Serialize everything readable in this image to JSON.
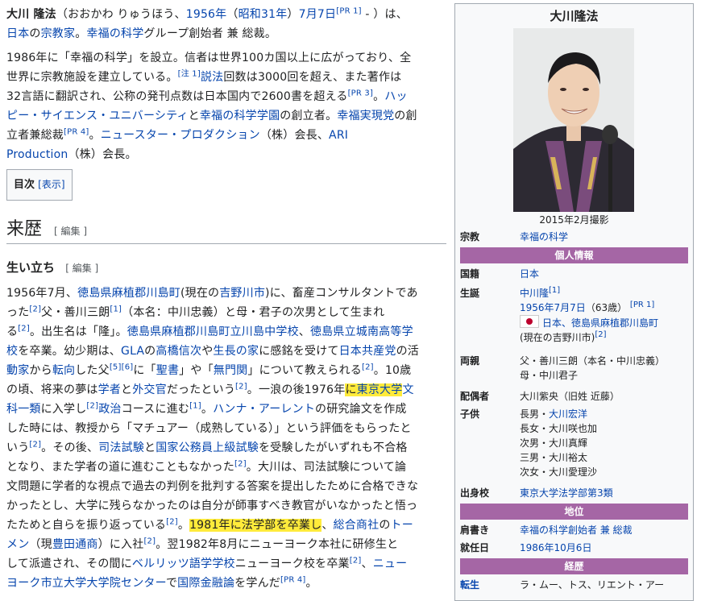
{
  "intro": {
    "p1": [
      {
        "t": "大川 隆法",
        "b": true
      },
      {
        "t": "（おおかわ りゅうほう、"
      },
      {
        "t": "1956年",
        "a": true
      },
      {
        "t": "（"
      },
      {
        "t": "昭和31年",
        "a": true
      },
      {
        "t": "）"
      },
      {
        "t": "7月7日",
        "a": true
      },
      {
        "t": "[PR 1]",
        "sup": true
      },
      {
        "t": " - ）は、"
      },
      {
        "br": true
      },
      {
        "t": "日本",
        "a": true
      },
      {
        "t": "の"
      },
      {
        "t": "宗教家",
        "a": true
      },
      {
        "t": "。"
      },
      {
        "t": "幸福の科学",
        "a": true
      },
      {
        "t": "グループ創始者 兼 総裁。"
      }
    ],
    "p2": [
      {
        "t": "1986年に「幸福の科学」を設立。信者は世界100カ国以上に広がっており、全"
      },
      {
        "br": true
      },
      {
        "t": "世界に宗教施設を建立している。"
      },
      {
        "t": "[注 1]",
        "sup": true
      },
      {
        "t": "説法",
        "a": true
      },
      {
        "t": "回数は3000回を超え、また著作は"
      },
      {
        "br": true
      },
      {
        "t": "32言語に翻訳され、公称の発刊点数は日本国内で2600書を超える"
      },
      {
        "t": "[PR 3]",
        "sup": true
      },
      {
        "t": "。"
      },
      {
        "t": "ハッ",
        "a": true
      },
      {
        "br": true
      },
      {
        "t": "ピー・サイエンス・ユニバーシティ",
        "a": true
      },
      {
        "t": "と"
      },
      {
        "t": "幸福の科学学園",
        "a": true
      },
      {
        "t": "の創立者。"
      },
      {
        "t": "幸福実現党",
        "a": true
      },
      {
        "t": "の創"
      },
      {
        "br": true
      },
      {
        "t": "立者兼総裁"
      },
      {
        "t": "[PR 4]",
        "sup": true
      },
      {
        "t": "。"
      },
      {
        "t": "ニュースター・プロダクション",
        "a": true
      },
      {
        "t": "（株）会長、"
      },
      {
        "t": "ARI",
        "a": true
      },
      {
        "br": true
      },
      {
        "t": "Production",
        "a": true
      },
      {
        "t": "（株）会長。"
      }
    ]
  },
  "toc": {
    "title": "目次",
    "toggle": "[表示]"
  },
  "section": {
    "title": "来歴",
    "edit": "[ 編集 ]"
  },
  "subsection": {
    "title": "生い立ち",
    "edit": "[ 編集 ]"
  },
  "body": [
    {
      "t": "1956年7月、"
    },
    {
      "t": "徳島県麻植郡川島町",
      "a": true
    },
    {
      "t": "(現在の"
    },
    {
      "t": "吉野川市",
      "a": true
    },
    {
      "t": ")に、畜産コンサルタントであ"
    },
    {
      "br": true
    },
    {
      "t": "った"
    },
    {
      "t": "[2]",
      "sup": true
    },
    {
      "t": "父・善川三朗"
    },
    {
      "t": "[1]",
      "sup": true
    },
    {
      "t": "（本名：中川忠義）と母・君子の次男として生まれ"
    },
    {
      "br": true
    },
    {
      "t": "る"
    },
    {
      "t": "[2]",
      "sup": true
    },
    {
      "t": "。出生名は「隆」。"
    },
    {
      "t": "徳島県麻植郡川島町立川島中学校",
      "a": true
    },
    {
      "t": "、"
    },
    {
      "t": "徳島県立城南高等学",
      "a": true
    },
    {
      "br": true
    },
    {
      "t": "校",
      "a": true
    },
    {
      "t": "を卒業。幼少期は、"
    },
    {
      "t": "GLA",
      "a": true
    },
    {
      "t": "の"
    },
    {
      "t": "高橋信次",
      "a": true
    },
    {
      "t": "や"
    },
    {
      "t": "生長の家",
      "a": true
    },
    {
      "t": "に感銘を受けて"
    },
    {
      "t": "日本共産党",
      "a": true
    },
    {
      "t": "の活"
    },
    {
      "br": true
    },
    {
      "t": "動家",
      "a": true
    },
    {
      "t": "から"
    },
    {
      "t": "転向",
      "a": true
    },
    {
      "t": "した父"
    },
    {
      "t": "[5][6]",
      "sup": true
    },
    {
      "t": "に「"
    },
    {
      "t": "聖書",
      "a": true
    },
    {
      "t": "」や「"
    },
    {
      "t": "無門関",
      "a": true
    },
    {
      "t": "」について教えられる"
    },
    {
      "t": "[2]",
      "sup": true
    },
    {
      "t": "。10歳"
    },
    {
      "br": true
    },
    {
      "t": "の頃、将来の夢は"
    },
    {
      "t": "学者",
      "a": true
    },
    {
      "t": "と"
    },
    {
      "t": "外交官",
      "a": true
    },
    {
      "t": "だったという"
    },
    {
      "t": "[2]",
      "sup": true
    },
    {
      "t": "。一浪の後1976年"
    },
    {
      "t": "に",
      "hl": true
    },
    {
      "t": "東京大学",
      "a": true,
      "hl": true
    },
    {
      "t": "文",
      "a": true
    },
    {
      "br": true
    },
    {
      "t": "科一類",
      "a": true
    },
    {
      "t": "に入学し"
    },
    {
      "t": "[2]",
      "sup": true
    },
    {
      "t": "政治",
      "a": true
    },
    {
      "t": "コースに進む"
    },
    {
      "t": "[1]",
      "sup": true
    },
    {
      "t": "。"
    },
    {
      "t": "ハンナ・アーレント",
      "a": true
    },
    {
      "t": "の研究論文を作成"
    },
    {
      "br": true
    },
    {
      "t": "した時には、教授から「マチュアー（成熟している）」という評価をもらったと"
    },
    {
      "br": true
    },
    {
      "t": "いう"
    },
    {
      "t": "[2]",
      "sup": true
    },
    {
      "t": "。その後、"
    },
    {
      "t": "司法試験",
      "a": true
    },
    {
      "t": "と"
    },
    {
      "t": "国家公務員上級試験",
      "a": true
    },
    {
      "t": "を受験したがいずれも不合格"
    },
    {
      "br": true
    },
    {
      "t": "となり、また学者の道に進むこともなかった"
    },
    {
      "t": "[2]",
      "sup": true
    },
    {
      "t": "。大川は、司法試験について論"
    },
    {
      "br": true
    },
    {
      "t": "文問題に学者的な視点で過去の判例を批判する答案を提出したために合格できな"
    },
    {
      "br": true
    },
    {
      "t": "かったとし、大学に残らなかったのは自分が師事すべき教官がいなかったと悟っ"
    },
    {
      "br": true
    },
    {
      "t": "たためと自らを振り返っている"
    },
    {
      "t": "[2]",
      "sup": true
    },
    {
      "t": "。"
    },
    {
      "t": "1981年に法学部を卒業し",
      "hl": true
    },
    {
      "t": "、"
    },
    {
      "t": "総合商社",
      "a": true
    },
    {
      "t": "の"
    },
    {
      "t": "トー",
      "a": true
    },
    {
      "br": true
    },
    {
      "t": "メン",
      "a": true
    },
    {
      "t": "（現"
    },
    {
      "t": "豊田通商",
      "a": true
    },
    {
      "t": "）に入社"
    },
    {
      "t": "[2]",
      "sup": true
    },
    {
      "t": "。翌1982年8月にニューヨーク本社に研修生と"
    },
    {
      "br": true
    },
    {
      "t": "して派遣され、その間に"
    },
    {
      "t": "ベルリッツ語学学校",
      "a": true
    },
    {
      "t": "ニューヨーク校を卒業"
    },
    {
      "t": "[2]",
      "sup": true
    },
    {
      "t": "、"
    },
    {
      "t": "ニュー",
      "a": true
    },
    {
      "br": true
    },
    {
      "t": "ヨーク市立大学大学院センター",
      "a": true
    },
    {
      "t": "で"
    },
    {
      "t": "国際金融論",
      "a": true
    },
    {
      "t": "を学んだ"
    },
    {
      "t": "[PR 4]",
      "sup": true
    },
    {
      "t": "。"
    }
  ],
  "infobox": {
    "title": "大川隆法",
    "caption": "2015年2月撮影",
    "religion_label": "宗教",
    "religion_value": "幸福の科学",
    "band_personal": "個人情報",
    "nationality_label": "国籍",
    "nationality_value": "日本",
    "birth_label": "生誕",
    "birth_name": "中川隆",
    "birth_name_sup": "[1]",
    "birth_date": "1956年7月7日",
    "birth_age": "（63歳）",
    "birth_date_sup": "[PR 1]",
    "birth_place": "日本、徳島県麻植郡川島町",
    "birth_place2": "(現在の吉野川市)",
    "birth_place_sup": "[2]",
    "parents_label": "両親",
    "parents_1": "父・善川三朗（本名・中川忠義）",
    "parents_2": "母・中川君子",
    "spouse_label": "配偶者",
    "spouse_value": "大川紫央（旧姓 近藤）",
    "children_label": "子供",
    "children": [
      {
        "rel": "長男・",
        "name": "大川宏洋",
        "link": true
      },
      {
        "rel": "長女・大川咲也加",
        "name": "",
        "link": false
      },
      {
        "rel": "次男・大川真輝",
        "name": "",
        "link": false
      },
      {
        "rel": "三男・大川裕太",
        "name": "",
        "link": false
      },
      {
        "rel": "次女・大川愛理沙",
        "name": "",
        "link": false
      }
    ],
    "school_label": "出身校",
    "school_value": "東京大学法学部第3類",
    "band_position": "地位",
    "title_label": "肩書き",
    "title_value": "幸福の科学創始者 兼 総裁",
    "inaug_label": "就任日",
    "inaug_value": "1986年10月6日",
    "band_history": "経歴",
    "reborn_label": "転生",
    "reborn_value": "ラ・ムー、トス、リエント・アー"
  },
  "colors": {
    "link": "#0645ad",
    "highlight": "#ffeb3b",
    "band": "#a566a5"
  }
}
